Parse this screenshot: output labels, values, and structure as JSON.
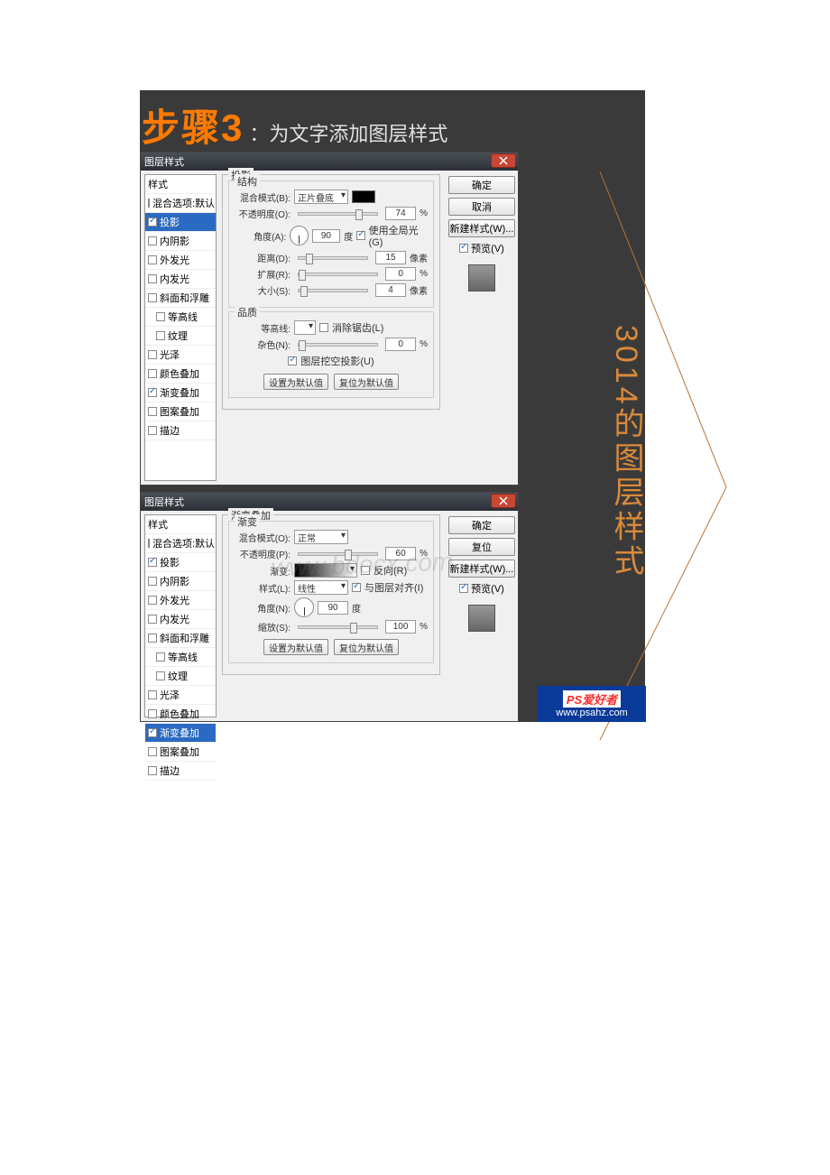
{
  "step": {
    "num": "步骤3",
    "txt": "：为文字添加图层样式"
  },
  "dialog_title": "图层样式",
  "close": "x",
  "sidebar": {
    "items": [
      {
        "label": "样式",
        "ck": false,
        "sel": false,
        "hdr": true
      },
      {
        "label": "混合选项:默认",
        "ck": false,
        "sel": false
      },
      {
        "label": "投影",
        "ck": true,
        "sel": true
      },
      {
        "label": "内阴影",
        "ck": false,
        "sel": false
      },
      {
        "label": "外发光",
        "ck": false,
        "sel": false
      },
      {
        "label": "内发光",
        "ck": false,
        "sel": false
      },
      {
        "label": "斜面和浮雕",
        "ck": false,
        "sel": false
      },
      {
        "label": "等高线",
        "ck": false,
        "sel": false,
        "ind": true
      },
      {
        "label": "纹理",
        "ck": false,
        "sel": false,
        "ind": true
      },
      {
        "label": "光泽",
        "ck": false,
        "sel": false
      },
      {
        "label": "颜色叠加",
        "ck": false,
        "sel": false
      },
      {
        "label": "渐变叠加",
        "ck": true,
        "sel": false
      },
      {
        "label": "图案叠加",
        "ck": false,
        "sel": false
      },
      {
        "label": "描边",
        "ck": false,
        "sel": false
      }
    ]
  },
  "sidebar2": {
    "items": [
      {
        "label": "样式",
        "hdr": true
      },
      {
        "label": "混合选项:默认"
      },
      {
        "label": "投影",
        "ck": true
      },
      {
        "label": "内阴影"
      },
      {
        "label": "外发光"
      },
      {
        "label": "内发光"
      },
      {
        "label": "斜面和浮雕"
      },
      {
        "label": "等高线",
        "ind": true
      },
      {
        "label": "纹理",
        "ind": true
      },
      {
        "label": "光泽"
      },
      {
        "label": "颜色叠加"
      },
      {
        "label": "渐变叠加",
        "ck": true,
        "sel": true
      },
      {
        "label": "图案叠加"
      },
      {
        "label": "描边"
      }
    ]
  },
  "shadow": {
    "group_label": "投影",
    "struct_label": "结构",
    "blend_label": "混合模式(B):",
    "blend_value": "正片叠底",
    "opacity_label": "不透明度(O):",
    "opacity_value": "74",
    "pct": "%",
    "angle_label": "角度(A):",
    "angle_value": "90",
    "deg": "度",
    "global_label": "使用全局光(G)",
    "dist_label": "距离(D):",
    "dist_value": "15",
    "px": "像素",
    "spread_label": "扩展(R):",
    "spread_value": "0",
    "size_label": "大小(S):",
    "size_value": "4",
    "quality_label": "品质",
    "contour_label": "等高线:",
    "antialias_label": "消除锯齿(L)",
    "noise_label": "杂色(N):",
    "noise_value": "0",
    "knockout_label": "图层挖空投影(U)",
    "make_default": "设置为默认值",
    "reset_default": "复位为默认值"
  },
  "grad": {
    "group_label": "渐变叠加",
    "sub_label": "渐变",
    "blend_label": "混合模式(O):",
    "blend_value": "正常",
    "opacity_label": "不透明度(P):",
    "opacity_value": "60",
    "pct": "%",
    "grad_label": "渐变:",
    "reverse_label": "反向(R)",
    "style_label": "样式(L):",
    "style_value": "线性",
    "align_label": "与图层对齐(I)",
    "angle_label": "角度(N):",
    "angle_value": "90",
    "deg": "度",
    "scale_label": "缩放(S):",
    "scale_value": "100",
    "make_default": "设置为默认值",
    "reset_default": "复位为默认值"
  },
  "buttons": {
    "ok": "确定",
    "cancel": "取消",
    "reset": "复位",
    "new_style": "新建样式(W)...",
    "preview": "预览(V)"
  },
  "side_caption": "3014的图层样式",
  "brand": {
    "l1": "PS爱好者",
    "l2": "www.psahz.com"
  },
  "wm": "www.bdocx.com"
}
